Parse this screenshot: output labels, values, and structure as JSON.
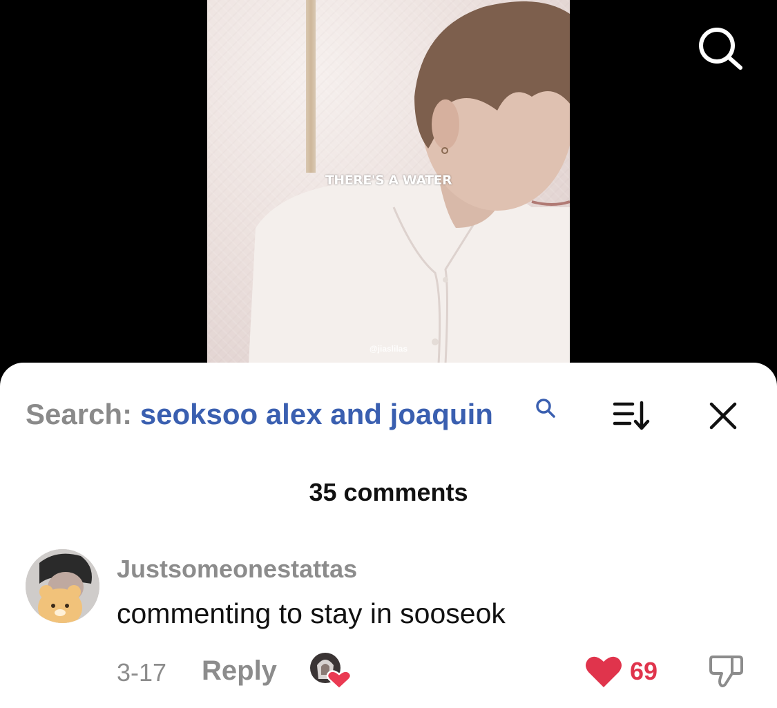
{
  "video": {
    "caption": "THERE'S A WATER",
    "watermark": "@jiaslilas"
  },
  "search": {
    "label": "Search:",
    "query": "seoksoo alex and joaquin"
  },
  "comments_header": {
    "count_label": "35 comments"
  },
  "comments": [
    {
      "username": "Justsomeonestattas",
      "text": "commenting to stay in sooseok",
      "date": "3-17",
      "reply_label": "Reply",
      "likes": "69"
    }
  ],
  "colors": {
    "query_blue": "#3a5fb0",
    "like_red": "#e0344c",
    "muted_gray": "#8c8c8c"
  },
  "icons": [
    "search-icon",
    "query-search-icon",
    "sort-icon",
    "close-icon",
    "heart-icon",
    "dislike-icon"
  ]
}
